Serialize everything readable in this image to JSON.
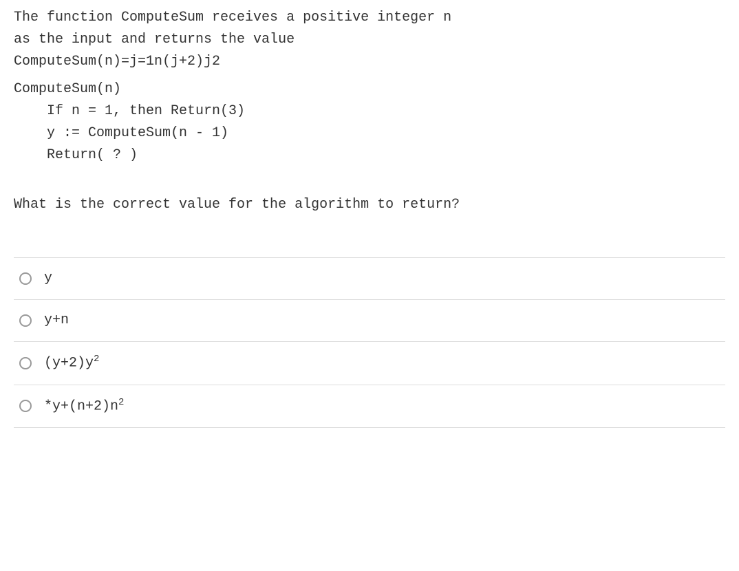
{
  "question": {
    "intro_line1": "The  function ComputeSum receives a positive integer n",
    "intro_line2": "as the input and returns the value",
    "formula": "ComputeSum(n)=j=1n(j+2)j2",
    "algo_header": "ComputeSum(n)",
    "algo_line1": "If n = 1, then Return(3)",
    "algo_line2": "y := ComputeSum(n - 1)",
    "algo_line3": "Return( ? )"
  },
  "prompt": "What is the correct value for the algorithm to return?",
  "options": {
    "a": "y",
    "b": "y+n",
    "c_pre": "(y+2)y",
    "c_sup": "2",
    "d_pre": "*y+(n+2)n",
    "d_sup": "2"
  }
}
